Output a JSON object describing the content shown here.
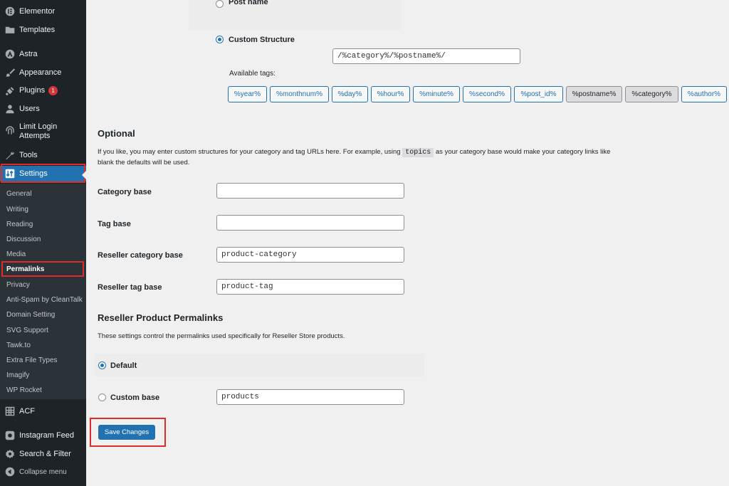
{
  "sidebar": {
    "items": [
      {
        "key": "elementor",
        "label": "Elementor",
        "icon": "elementor-icon"
      },
      {
        "key": "templates",
        "label": "Templates",
        "icon": "folder-icon"
      },
      {
        "key": "astra",
        "label": "Astra",
        "icon": "astra-icon"
      },
      {
        "key": "appearance",
        "label": "Appearance",
        "icon": "paintbrush-icon"
      },
      {
        "key": "plugins",
        "label": "Plugins",
        "icon": "plugin-icon",
        "badge": "1"
      },
      {
        "key": "users",
        "label": "Users",
        "icon": "user-icon"
      },
      {
        "key": "limit-login",
        "label": "Limit Login Attempts",
        "label_line1": "Limit Login",
        "label_line2": "Attempts",
        "icon": "fingerprint-icon"
      },
      {
        "key": "tools",
        "label": "Tools",
        "icon": "wrench-icon"
      },
      {
        "key": "settings",
        "label": "Settings",
        "icon": "settings-icon",
        "current": true
      },
      {
        "key": "acf",
        "label": "ACF",
        "icon": "grid-icon"
      },
      {
        "key": "instagram",
        "label": "Instagram Feed",
        "icon": "instagram-icon"
      },
      {
        "key": "search-filter",
        "label": "Search & Filter",
        "icon": "gear-icon"
      },
      {
        "key": "collapse",
        "label": "Collapse menu",
        "icon": "collapse-icon"
      }
    ],
    "submenu": [
      "General",
      "Writing",
      "Reading",
      "Discussion",
      "Media",
      "Permalinks",
      "Privacy",
      "Anti-Spam by CleanTalk",
      "Domain Setting",
      "SVG Support",
      "Tawk.to",
      "Extra File Types",
      "Imagify",
      "WP Rocket"
    ],
    "submenu_active": "Permalinks"
  },
  "common_settings": {
    "post_name_label": "Post name",
    "custom_structure_label": "Custom Structure",
    "custom_structure_value": "/%category%/%postname%/",
    "available_tags_label": "Available tags:",
    "tags": [
      "%year%",
      "%monthnum%",
      "%day%",
      "%hour%",
      "%minute%",
      "%second%",
      "%post_id%",
      "%postname%",
      "%category%",
      "%author%"
    ],
    "pressed_tags": [
      "%postname%",
      "%category%"
    ]
  },
  "optional": {
    "title": "Optional",
    "desc_line1_a": "If you like, you may enter custom structures for your category and tag URLs here. For example, using",
    "desc_code": "topics",
    "desc_line1_b": "as your category base would make your category links like",
    "desc_line2": "blank the defaults will be used.",
    "fields": [
      {
        "label": "Category base",
        "value": ""
      },
      {
        "label": "Tag base",
        "value": ""
      },
      {
        "label": "Reseller category base",
        "value": "product-category"
      },
      {
        "label": "Reseller tag base",
        "value": "product-tag"
      }
    ]
  },
  "reseller": {
    "title": "Reseller Product Permalinks",
    "desc": "These settings control the permalinks used specifically for Reseller Store products.",
    "default_label": "Default",
    "custom_label": "Custom base",
    "custom_value": "products"
  },
  "actions": {
    "save_label": "Save Changes"
  },
  "colors": {
    "accent": "#2271b1",
    "sidebar_bg": "#1d2327",
    "highlight_outline": "#e02b2b"
  }
}
